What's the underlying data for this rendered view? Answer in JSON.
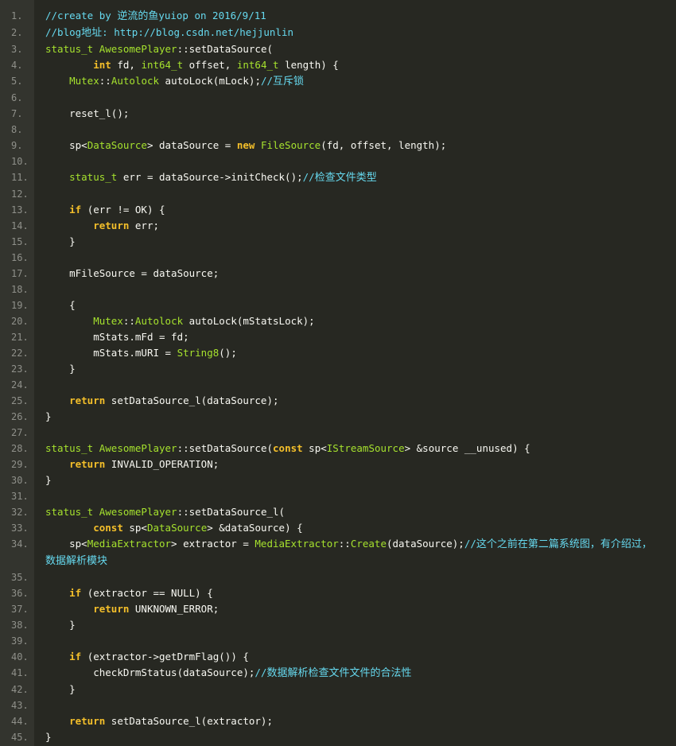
{
  "colors": {
    "background": "#272822",
    "gutter_background": "#33342e",
    "line_number": "#8f908a",
    "plain": "#f8f8f2",
    "comment": "#66d9ef",
    "keyword": "#f4bf2a",
    "type": "#a6e22e"
  },
  "code": {
    "language": "cpp",
    "lines": [
      {
        "num": "1.",
        "tokens": [
          [
            "c",
            "//create by "
          ],
          [
            "c",
            "逆流的鱼"
          ],
          [
            "c",
            "yuiop on 2016/9/11"
          ]
        ]
      },
      {
        "num": "2.",
        "tokens": [
          [
            "c",
            "//blog"
          ],
          [
            "c",
            "地址"
          ],
          [
            "c",
            ": http://blog.csdn.net/hejjunlin"
          ]
        ]
      },
      {
        "num": "3.",
        "tokens": [
          [
            "t",
            "status_t"
          ],
          [
            "p",
            " "
          ],
          [
            "t",
            "AwesomePlayer"
          ],
          [
            "p",
            "::setDataSource("
          ]
        ]
      },
      {
        "num": "4.",
        "tokens": [
          [
            "p",
            "        "
          ],
          [
            "k",
            "int"
          ],
          [
            "p",
            " fd, "
          ],
          [
            "t",
            "int64_t"
          ],
          [
            "p",
            " offset, "
          ],
          [
            "t",
            "int64_t"
          ],
          [
            "p",
            " length) {"
          ]
        ]
      },
      {
        "num": "5.",
        "tokens": [
          [
            "p",
            "    "
          ],
          [
            "t",
            "Mutex"
          ],
          [
            "p",
            "::"
          ],
          [
            "t",
            "Autolock"
          ],
          [
            "p",
            " autoLock(mLock);"
          ],
          [
            "c",
            "//"
          ],
          [
            "c",
            "互斥锁"
          ]
        ]
      },
      {
        "num": "6.",
        "tokens": []
      },
      {
        "num": "7.",
        "tokens": [
          [
            "p",
            "    reset_l();"
          ]
        ]
      },
      {
        "num": "8.",
        "tokens": []
      },
      {
        "num": "9.",
        "tokens": [
          [
            "p",
            "    sp<"
          ],
          [
            "t",
            "DataSource"
          ],
          [
            "p",
            "> dataSource = "
          ],
          [
            "k",
            "new"
          ],
          [
            "p",
            " "
          ],
          [
            "t",
            "FileSource"
          ],
          [
            "p",
            "(fd, offset, length);"
          ]
        ]
      },
      {
        "num": "10.",
        "tokens": []
      },
      {
        "num": "11.",
        "tokens": [
          [
            "p",
            "    "
          ],
          [
            "t",
            "status_t"
          ],
          [
            "p",
            " err = dataSource->initCheck();"
          ],
          [
            "c",
            "//"
          ],
          [
            "c",
            "检查文件类型"
          ]
        ]
      },
      {
        "num": "12.",
        "tokens": []
      },
      {
        "num": "13.",
        "tokens": [
          [
            "p",
            "    "
          ],
          [
            "k",
            "if"
          ],
          [
            "p",
            " (err != OK) {"
          ]
        ]
      },
      {
        "num": "14.",
        "tokens": [
          [
            "p",
            "        "
          ],
          [
            "k",
            "return"
          ],
          [
            "p",
            " err;"
          ]
        ]
      },
      {
        "num": "15.",
        "tokens": [
          [
            "p",
            "    }"
          ]
        ]
      },
      {
        "num": "16.",
        "tokens": []
      },
      {
        "num": "17.",
        "tokens": [
          [
            "p",
            "    mFileSource = dataSource;"
          ]
        ]
      },
      {
        "num": "18.",
        "tokens": []
      },
      {
        "num": "19.",
        "tokens": [
          [
            "p",
            "    {"
          ]
        ]
      },
      {
        "num": "20.",
        "tokens": [
          [
            "p",
            "        "
          ],
          [
            "t",
            "Mutex"
          ],
          [
            "p",
            "::"
          ],
          [
            "t",
            "Autolock"
          ],
          [
            "p",
            " autoLock(mStatsLock);"
          ]
        ]
      },
      {
        "num": "21.",
        "tokens": [
          [
            "p",
            "        mStats.mFd = fd;"
          ]
        ]
      },
      {
        "num": "22.",
        "tokens": [
          [
            "p",
            "        mStats.mURI = "
          ],
          [
            "t",
            "String8"
          ],
          [
            "p",
            "();"
          ]
        ]
      },
      {
        "num": "23.",
        "tokens": [
          [
            "p",
            "    }"
          ]
        ]
      },
      {
        "num": "24.",
        "tokens": []
      },
      {
        "num": "25.",
        "tokens": [
          [
            "p",
            "    "
          ],
          [
            "k",
            "return"
          ],
          [
            "p",
            " setDataSource_l(dataSource);"
          ]
        ]
      },
      {
        "num": "26.",
        "tokens": [
          [
            "p",
            "}"
          ]
        ]
      },
      {
        "num": "27.",
        "tokens": []
      },
      {
        "num": "28.",
        "tokens": [
          [
            "t",
            "status_t"
          ],
          [
            "p",
            " "
          ],
          [
            "t",
            "AwesomePlayer"
          ],
          [
            "p",
            "::setDataSource("
          ],
          [
            "k",
            "const"
          ],
          [
            "p",
            " sp<"
          ],
          [
            "t",
            "IStreamSource"
          ],
          [
            "p",
            "> &source __unused) {"
          ]
        ]
      },
      {
        "num": "29.",
        "tokens": [
          [
            "p",
            "    "
          ],
          [
            "k",
            "return"
          ],
          [
            "p",
            " INVALID_OPERATION;"
          ]
        ]
      },
      {
        "num": "30.",
        "tokens": [
          [
            "p",
            "}"
          ]
        ]
      },
      {
        "num": "31.",
        "tokens": []
      },
      {
        "num": "32.",
        "tokens": [
          [
            "t",
            "status_t"
          ],
          [
            "p",
            " "
          ],
          [
            "t",
            "AwesomePlayer"
          ],
          [
            "p",
            "::setDataSource_l("
          ]
        ]
      },
      {
        "num": "33.",
        "tokens": [
          [
            "p",
            "        "
          ],
          [
            "k",
            "const"
          ],
          [
            "p",
            " sp<"
          ],
          [
            "t",
            "DataSource"
          ],
          [
            "p",
            "> &dataSource) {"
          ]
        ]
      },
      {
        "num": "34.",
        "tokens": [
          [
            "p",
            "    sp<"
          ],
          [
            "t",
            "MediaExtractor"
          ],
          [
            "p",
            "> extractor = "
          ],
          [
            "t",
            "MediaExtractor"
          ],
          [
            "p",
            "::"
          ],
          [
            "t",
            "Create"
          ],
          [
            "p",
            "(dataSource);"
          ],
          [
            "c",
            "//"
          ],
          [
            "c",
            "这个之前在第二篇系统图，有介绍过，数据解析模块"
          ]
        ]
      },
      {
        "num": "35.",
        "tokens": []
      },
      {
        "num": "36.",
        "tokens": [
          [
            "p",
            "    "
          ],
          [
            "k",
            "if"
          ],
          [
            "p",
            " (extractor == NULL) {"
          ]
        ]
      },
      {
        "num": "37.",
        "tokens": [
          [
            "p",
            "        "
          ],
          [
            "k",
            "return"
          ],
          [
            "p",
            " UNKNOWN_ERROR;"
          ]
        ]
      },
      {
        "num": "38.",
        "tokens": [
          [
            "p",
            "    }"
          ]
        ]
      },
      {
        "num": "39.",
        "tokens": []
      },
      {
        "num": "40.",
        "tokens": [
          [
            "p",
            "    "
          ],
          [
            "k",
            "if"
          ],
          [
            "p",
            " (extractor->getDrmFlag()) {"
          ]
        ]
      },
      {
        "num": "41.",
        "tokens": [
          [
            "p",
            "        checkDrmStatus(dataSource);"
          ],
          [
            "c",
            "//"
          ],
          [
            "c",
            "数据解析检查文件文件的合法性"
          ]
        ]
      },
      {
        "num": "42.",
        "tokens": [
          [
            "p",
            "    }"
          ]
        ]
      },
      {
        "num": "43.",
        "tokens": []
      },
      {
        "num": "44.",
        "tokens": [
          [
            "p",
            "    "
          ],
          [
            "k",
            "return"
          ],
          [
            "p",
            " setDataSource_l(extractor);"
          ]
        ]
      },
      {
        "num": "45.",
        "tokens": [
          [
            "p",
            "}"
          ]
        ]
      }
    ]
  }
}
